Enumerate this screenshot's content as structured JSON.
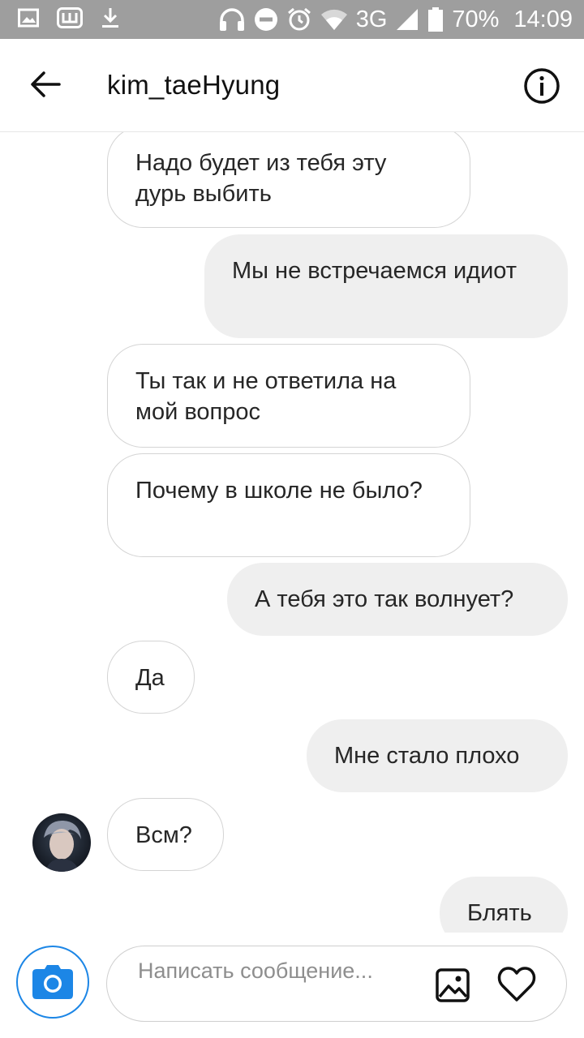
{
  "status_bar": {
    "network": "3G",
    "battery": "70%",
    "time": "14:09",
    "icons": [
      "image-icon",
      "app-icon",
      "download-icon",
      "headphones-icon",
      "dnd-icon",
      "alarm-icon",
      "wifi-icon",
      "signal-icon",
      "battery-icon"
    ]
  },
  "header": {
    "title": "kim_taeHyung",
    "back_icon": "arrow-left-icon",
    "info_icon": "info-icon"
  },
  "messages": [
    {
      "direction": "in",
      "text": "Надо будет из тебя эту дурь выбить"
    },
    {
      "direction": "out",
      "text": "Мы не встречаемся идиот"
    },
    {
      "direction": "in",
      "text": "Ты так и не ответила на мой вопрос"
    },
    {
      "direction": "in",
      "text": "Почему в школе не было?"
    },
    {
      "direction": "out",
      "text": "А тебя это так волнует?"
    },
    {
      "direction": "in",
      "text": "Да"
    },
    {
      "direction": "out",
      "text": "Мне стало плохо"
    },
    {
      "direction": "in",
      "text": "Всм?"
    },
    {
      "direction": "out",
      "text": "Блять"
    }
  ],
  "composer": {
    "placeholder": "Написать сообщение...",
    "camera_icon": "camera-icon",
    "gallery_icon": "gallery-icon",
    "like_icon": "heart-icon"
  },
  "colors": {
    "status_bar_bg": "#9e9e9e",
    "outgoing_bubble": "#efefef",
    "incoming_border": "#d4d4d4",
    "camera_accent": "#1c86e6"
  }
}
